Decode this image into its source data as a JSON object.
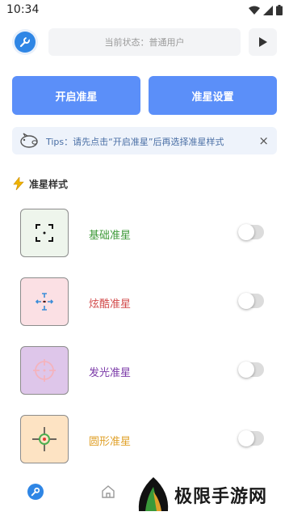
{
  "status_bar": {
    "time": "10:34"
  },
  "header": {
    "state_text": "当前状态：普通用户"
  },
  "buttons": {
    "open_crosshair": "开启准星",
    "crosshair_settings": "准星设置"
  },
  "tips": {
    "text": "Tips：请先点击“开启准星”后再选择准星样式",
    "close": "×"
  },
  "section": {
    "title": "准星样式"
  },
  "styles": [
    {
      "label": "基础准星",
      "label_color": "#3f9a3a",
      "thumb_bg": "#eef5ec",
      "enabled": false,
      "icon": "basic-crosshair-icon"
    },
    {
      "label": "炫酷准星",
      "label_color": "#d24b4b",
      "thumb_bg": "#fbe0e4",
      "enabled": false,
      "icon": "cool-crosshair-icon"
    },
    {
      "label": "发光准星",
      "label_color": "#7b3aa8",
      "thumb_bg": "#dec6ea",
      "enabled": false,
      "icon": "glow-crosshair-icon"
    },
    {
      "label": "圆形准星",
      "label_color": "#e0a12a",
      "thumb_bg": "#fde3c3",
      "enabled": false,
      "icon": "round-crosshair-icon"
    }
  ],
  "watermark": {
    "text": "极限手游网"
  },
  "colors": {
    "accent": "#5b8ff9",
    "brand_blue": "#2f86e5"
  }
}
